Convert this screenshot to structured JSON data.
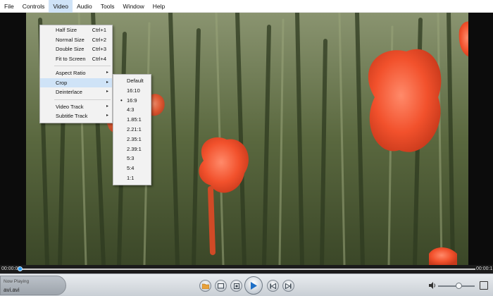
{
  "menubar": {
    "items": [
      "File",
      "Controls",
      "Video",
      "Audio",
      "Tools",
      "Window",
      "Help"
    ]
  },
  "video_menu": {
    "items": [
      {
        "label": "Half Size",
        "shortcut": "Ctrl+1"
      },
      {
        "label": "Normal Size",
        "shortcut": "Ctrl+2"
      },
      {
        "label": "Double Size",
        "shortcut": "Ctrl+3"
      },
      {
        "label": "Fit to Screen",
        "shortcut": "Ctrl+4"
      },
      {
        "label": "Aspect Ratio"
      },
      {
        "label": "Crop"
      },
      {
        "label": "Deinterlace"
      },
      {
        "label": "Video Track"
      },
      {
        "label": "Subtitle Track"
      }
    ],
    "submenu_arrow": "▸"
  },
  "crop_menu": {
    "items": [
      "Default",
      "16:10",
      "16:9",
      "4:3",
      "1.85:1",
      "2.21:1",
      "2.35:1",
      "2.39:1",
      "5:3",
      "5:4",
      "1:1"
    ],
    "selected": "16:9",
    "check_mark": "•"
  },
  "seekbar": {
    "time_elapsed": "00:00:00",
    "time_total": "00:00:1",
    "progress": 0.0
  },
  "now_playing": {
    "label": "Now Playing",
    "file": "avi.avi"
  },
  "controls": {
    "icons": [
      "open-file-icon",
      "folder-icon",
      "stop-icon",
      "play-icon",
      "previous-icon",
      "next-icon",
      "volume-icon",
      "fullscreen-icon"
    ],
    "volume_level": 0.5
  },
  "colors": {
    "menu_highlight": "#cfe3f7",
    "seek_knob": "#2aa0ff",
    "play_triangle": "#1f6fc6"
  }
}
